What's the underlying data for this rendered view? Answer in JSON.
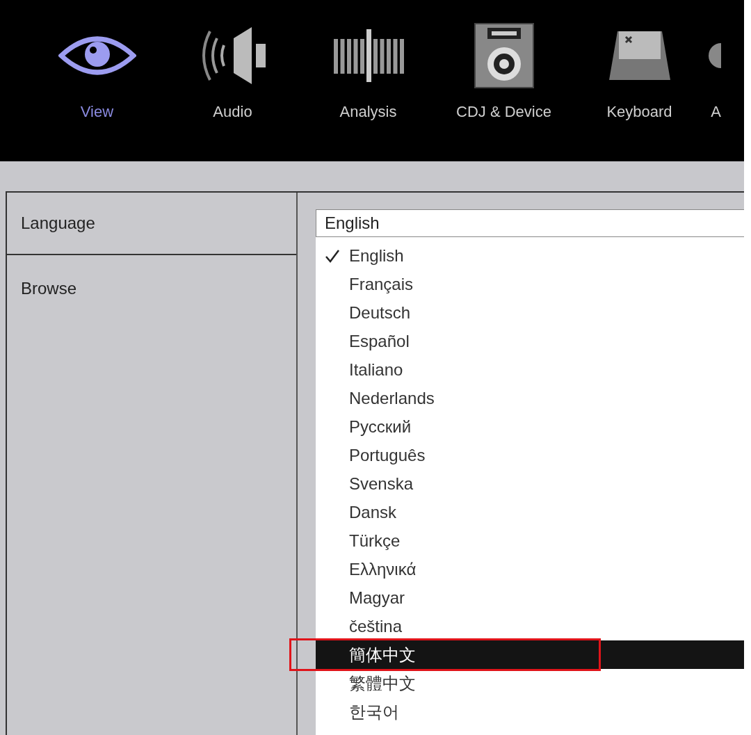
{
  "toolbar": {
    "tabs": [
      {
        "label": "View",
        "selected": true
      },
      {
        "label": "Audio",
        "selected": false
      },
      {
        "label": "Analysis",
        "selected": false
      },
      {
        "label": "CDJ & Device",
        "selected": false
      },
      {
        "label": "Keyboard",
        "selected": false
      },
      {
        "label": "A",
        "selected": false
      }
    ]
  },
  "settings": {
    "rows": [
      {
        "label": "Language"
      },
      {
        "label": "Browse"
      }
    ]
  },
  "language_select": {
    "value": "English"
  },
  "language_menu": {
    "items": [
      {
        "label": "English",
        "checked": true,
        "selected": false
      },
      {
        "label": "Français",
        "checked": false,
        "selected": false
      },
      {
        "label": "Deutsch",
        "checked": false,
        "selected": false
      },
      {
        "label": "Español",
        "checked": false,
        "selected": false
      },
      {
        "label": "Italiano",
        "checked": false,
        "selected": false
      },
      {
        "label": "Nederlands",
        "checked": false,
        "selected": false
      },
      {
        "label": "Русский",
        "checked": false,
        "selected": false
      },
      {
        "label": "Português",
        "checked": false,
        "selected": false
      },
      {
        "label": "Svenska",
        "checked": false,
        "selected": false
      },
      {
        "label": "Dansk",
        "checked": false,
        "selected": false
      },
      {
        "label": "Türkçe",
        "checked": false,
        "selected": false
      },
      {
        "label": "Ελληνικά",
        "checked": false,
        "selected": false
      },
      {
        "label": "Magyar",
        "checked": false,
        "selected": false
      },
      {
        "label": "čeština",
        "checked": false,
        "selected": false
      },
      {
        "label": "簡体中文",
        "checked": false,
        "selected": true
      },
      {
        "label": "繁體中文",
        "checked": false,
        "selected": false
      },
      {
        "label": "한국어",
        "checked": false,
        "selected": false
      }
    ]
  }
}
